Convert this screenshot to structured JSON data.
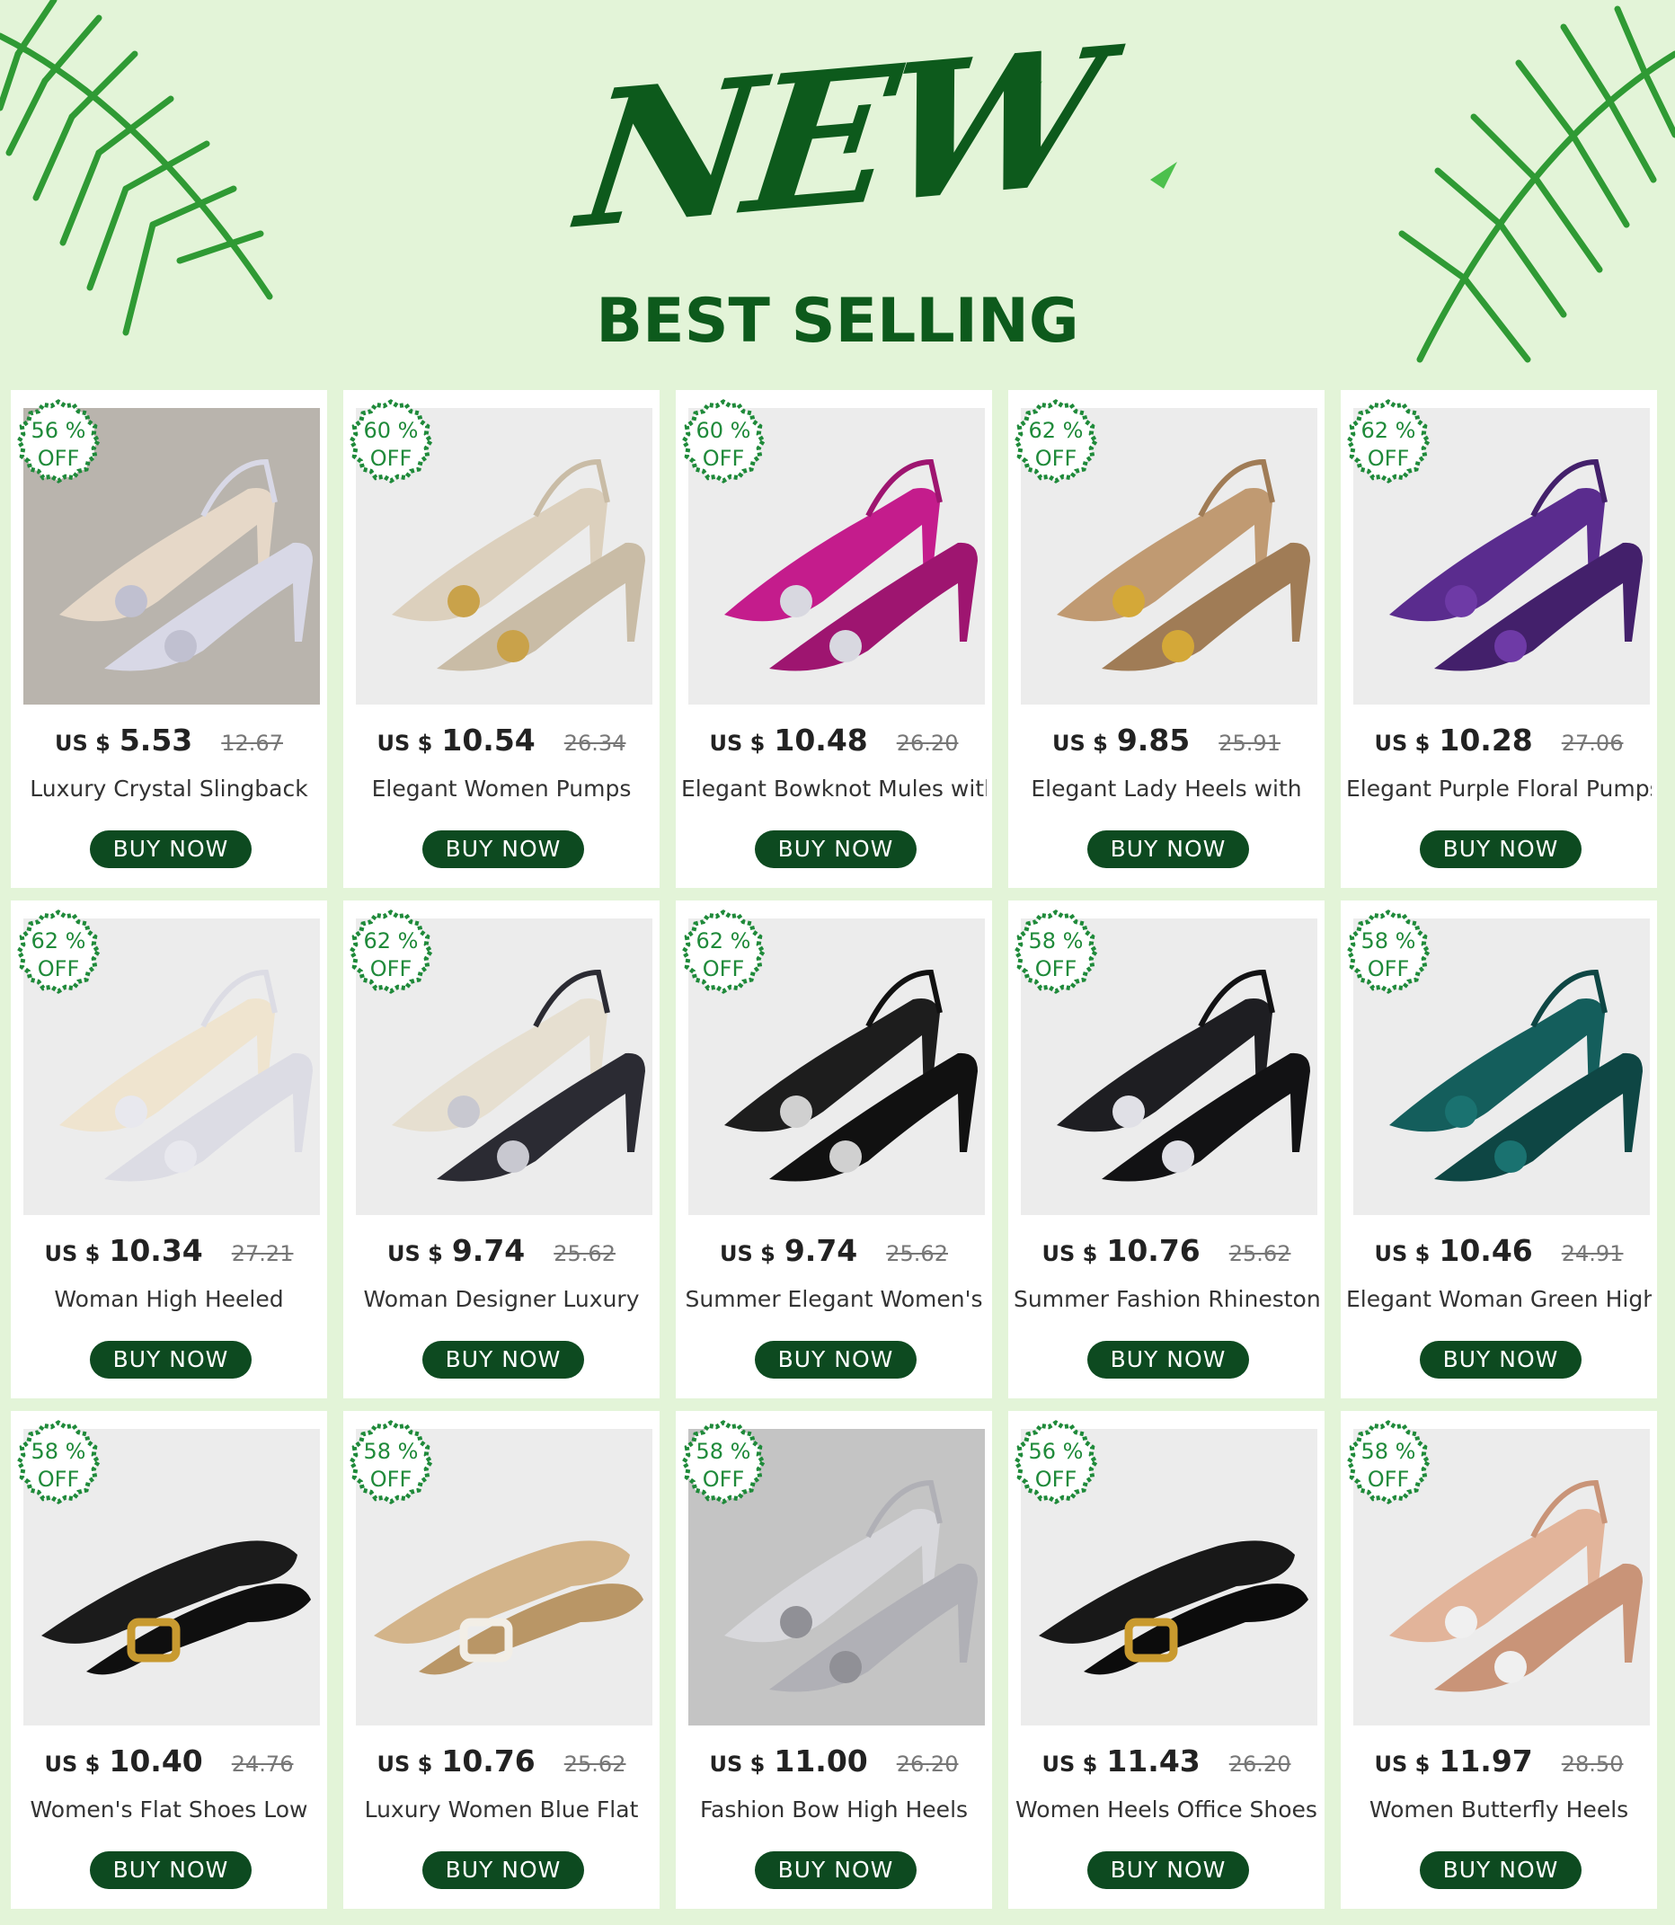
{
  "header": {
    "title": "NEW",
    "subtitle": "BEST SELLING"
  },
  "colors": {
    "brand_green": "#0d5a1c",
    "button_bg": "#0d4a20",
    "badge_green": "#1f8a3a",
    "background": "#e3f4d8"
  },
  "badge_off_label": "OFF",
  "buy_label": "BUY NOW",
  "currency": "US $",
  "products": [
    {
      "discount": "56 %",
      "price": "5.53",
      "original": "12.67",
      "title": "Luxury Crystal Slingback",
      "shoe": "clear"
    },
    {
      "discount": "60 %",
      "price": "10.54",
      "original": "26.34",
      "title": "Elegant Women Pumps",
      "shoe": "beige"
    },
    {
      "discount": "60 %",
      "price": "10.48",
      "original": "26.20",
      "title": "Elegant Bowknot Mules with",
      "shoe": "magenta"
    },
    {
      "discount": "62 %",
      "price": "9.85",
      "original": "25.91",
      "title": "Elegant Lady Heels with",
      "shoe": "tan"
    },
    {
      "discount": "62 %",
      "price": "10.28",
      "original": "27.06",
      "title": "Elegant Purple Floral Pumps",
      "shoe": "purple"
    },
    {
      "discount": "62 %",
      "price": "10.34",
      "original": "27.21",
      "title": "Woman High Heeled",
      "shoe": "cream"
    },
    {
      "discount": "62 %",
      "price": "9.74",
      "original": "25.62",
      "title": "Woman Designer Luxury",
      "shoe": "tweed"
    },
    {
      "discount": "62 %",
      "price": "9.74",
      "original": "25.62",
      "title": "Summer Elegant Women's",
      "shoe": "black"
    },
    {
      "discount": "58 %",
      "price": "10.76",
      "original": "25.62",
      "title": "Summer Fashion Rhinestone",
      "shoe": "studded"
    },
    {
      "discount": "58 %",
      "price": "10.46",
      "original": "24.91",
      "title": "Elegant Woman Green High",
      "shoe": "teal"
    },
    {
      "discount": "58 %",
      "price": "10.40",
      "original": "24.76",
      "title": "Women's Flat Shoes Low",
      "shoe": "blackflat"
    },
    {
      "discount": "58 %",
      "price": "10.76",
      "original": "25.62",
      "title": "Luxury Women Blue Flat",
      "shoe": "raffia"
    },
    {
      "discount": "58 %",
      "price": "11.00",
      "original": "26.20",
      "title": "Fashion Bow High Heels",
      "shoe": "silver"
    },
    {
      "discount": "56 %",
      "price": "11.43",
      "original": "26.20",
      "title": "Women Heels Office Shoes",
      "shoe": "blackgold"
    },
    {
      "discount": "58 %",
      "price": "11.97",
      "original": "28.50",
      "title": "Women Butterfly Heels",
      "shoe": "nude"
    }
  ]
}
